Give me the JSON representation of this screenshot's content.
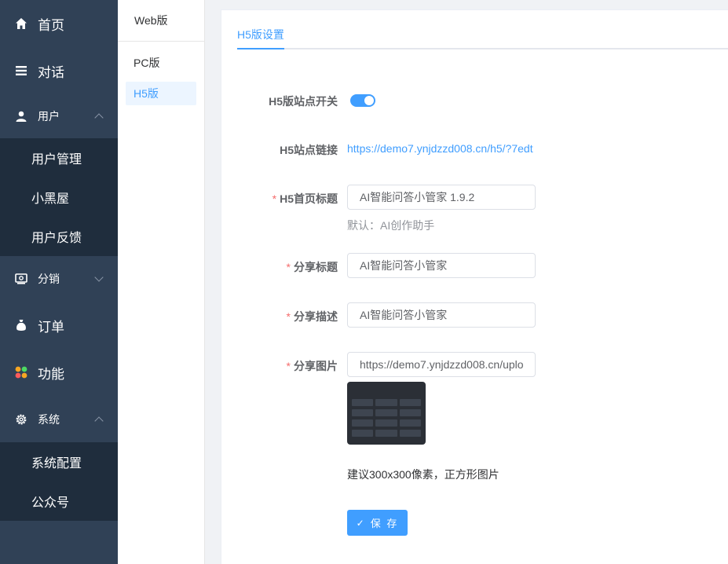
{
  "sidebar": {
    "home": "首页",
    "chat": "对话",
    "user": "用户",
    "user_sub": [
      "用户管理",
      "小黑屋",
      "用户反馈"
    ],
    "distribution": "分销",
    "order": "订单",
    "function": "功能",
    "system": "系统",
    "system_sub": [
      "系统配置",
      "公众号"
    ]
  },
  "subnav": {
    "header": "Web版",
    "items": [
      "PC版",
      "H5版"
    ]
  },
  "main": {
    "tab": "H5版设置",
    "form": {
      "site_switch_label": "H5版站点开关",
      "site_switch_on": true,
      "site_link_label": "H5站点链接",
      "site_link": "https://demo7.ynjdzzd008.cn/h5/?7edt",
      "home_title_label": "H5首页标题",
      "home_title_value": "AI智能问答小管家 1.9.2",
      "home_title_hint": "默认：AI创作助手",
      "share_title_label": "分享标题",
      "share_title_value": "AI智能问答小管家",
      "share_desc_label": "分享描述",
      "share_desc_value": "AI智能问答小管家",
      "share_image_label": "分享图片",
      "share_image_value": "https://demo7.ynjdzzd008.cn/uplo",
      "image_advice": "建议300x300像素，正方形图片",
      "required_mark": "*",
      "save_label": "保 存"
    }
  },
  "colors": {
    "sidebar_bg": "#304156",
    "submenu_bg": "#1f2d3d",
    "accent": "#409eff",
    "required": "#f56c6c"
  }
}
